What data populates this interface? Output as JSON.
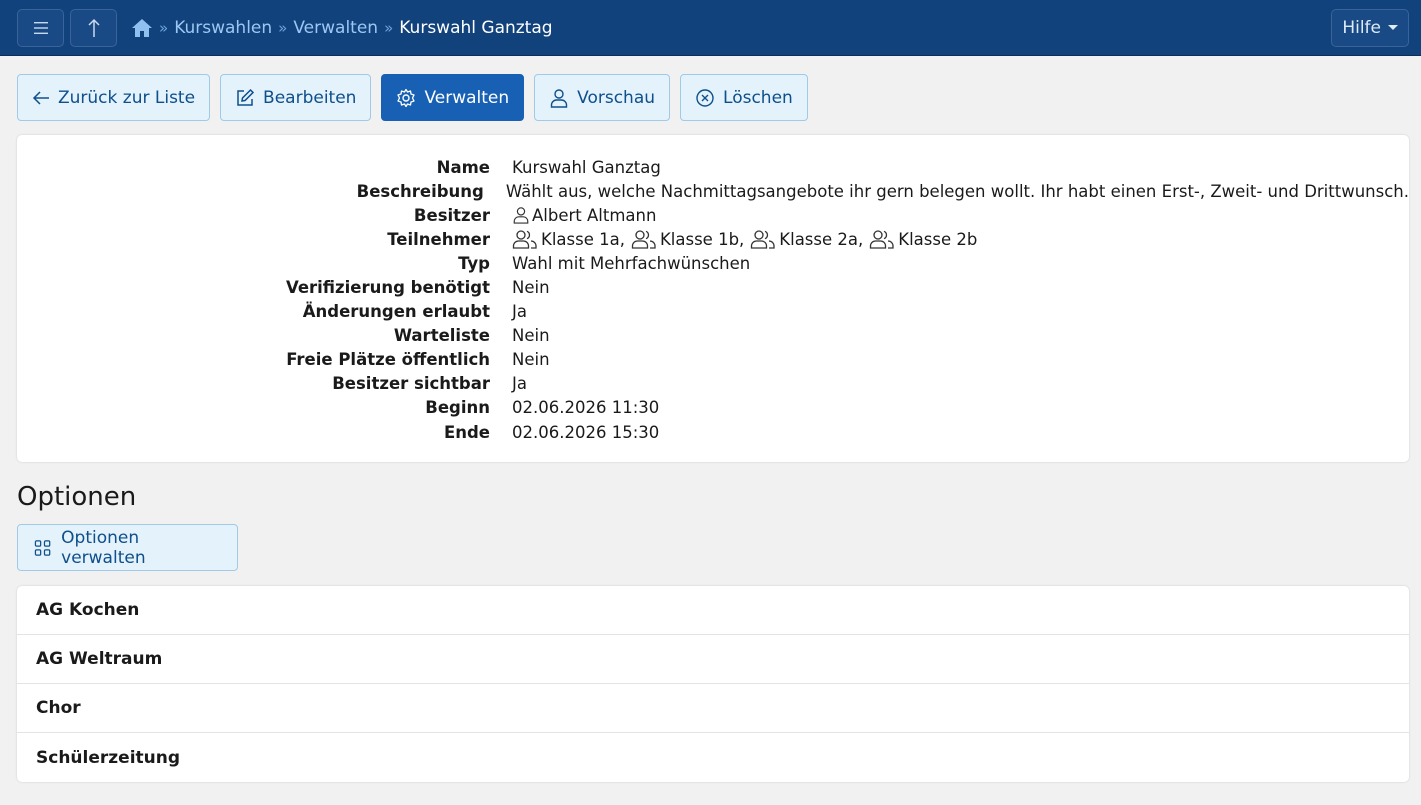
{
  "breadcrumb": {
    "items": [
      "Kurswahlen",
      "Verwalten"
    ],
    "separator": "»",
    "current": "Kurswahl Ganztag"
  },
  "header": {
    "help_label": "Hilfe"
  },
  "actions": {
    "back_label": "Zurück zur Liste",
    "edit_label": "Bearbeiten",
    "manage_label": "Verwalten",
    "preview_label": "Vorschau",
    "delete_label": "Löschen"
  },
  "details": {
    "name_label": "Name",
    "name": "Kurswahl Ganztag",
    "description_label": "Beschreibung",
    "description": "Wählt aus, welche Nachmittagsangebote ihr gern belegen wollt. Ihr habt einen Erst-, Zweit- und Drittwunsch.",
    "owner_label": "Besitzer",
    "owner": "Albert Altmann",
    "participants_label": "Teilnehmer",
    "participants": [
      "Klasse 1a,",
      "Klasse 1b,",
      "Klasse 2a,",
      "Klasse 2b"
    ],
    "type_label": "Typ",
    "type": "Wahl mit Mehrfachwünschen",
    "verification_label": "Verifizierung benötigt",
    "verification": "Nein",
    "changes_label": "Änderungen erlaubt",
    "changes": "Ja",
    "waitlist_label": "Warteliste",
    "waitlist": "Nein",
    "free_places_label": "Freie Plätze öffentlich",
    "free_places": "Nein",
    "owner_visible_label": "Besitzer sichtbar",
    "owner_visible": "Ja",
    "start_label": "Beginn",
    "start": "02.06.2026 11:30",
    "end_label": "Ende",
    "end": "02.06.2026 15:30"
  },
  "options": {
    "title": "Optionen",
    "manage_label": "Optionen verwalten",
    "items": [
      "AG Kochen",
      "AG Weltraum",
      "Chor",
      "Schülerzeitung"
    ]
  },
  "colors": {
    "topbar": "#11427b",
    "primary": "#1760b4",
    "light_button": "#e3f2fb"
  }
}
